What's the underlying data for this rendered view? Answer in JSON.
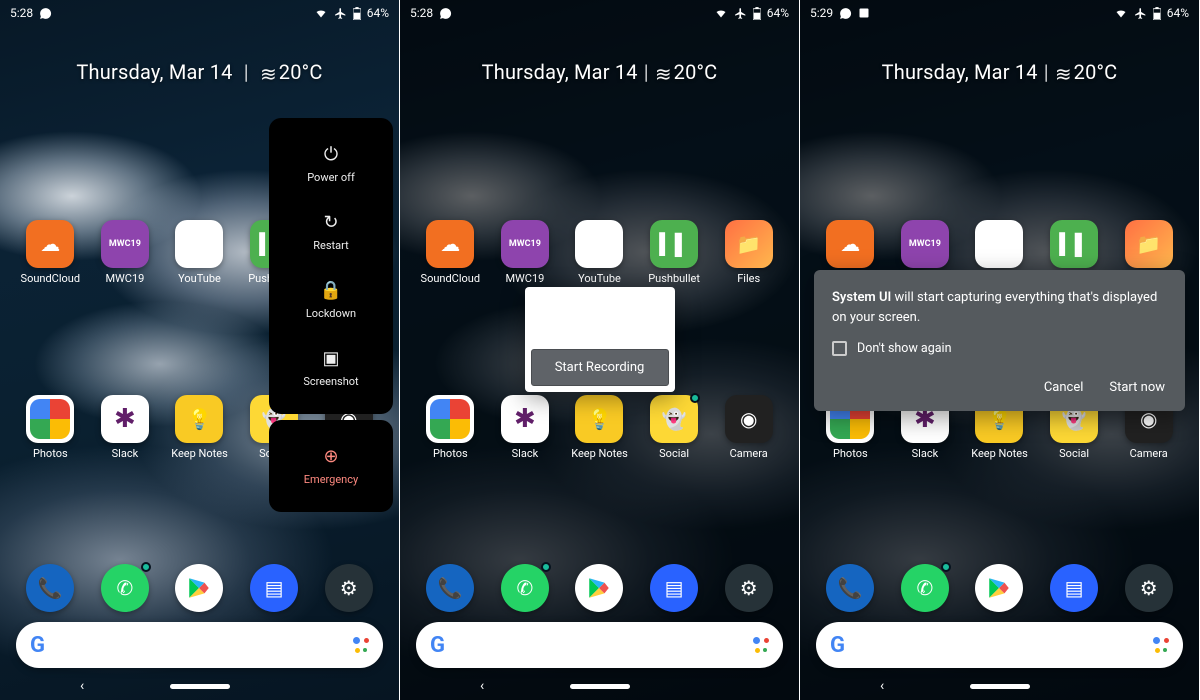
{
  "screens": [
    {
      "time": "5:28",
      "battery": "64%"
    },
    {
      "time": "5:28",
      "battery": "64%"
    },
    {
      "time": "5:29",
      "battery": "64%"
    }
  ],
  "date": "Thursday, Mar 14",
  "temp": "20°C",
  "apps_row1": [
    {
      "name": "SoundCloud",
      "cls": "c-soundcloud",
      "glyph": "☁"
    },
    {
      "name": "MWC19",
      "cls": "c-mwc",
      "glyph": ""
    },
    {
      "name": "YouTube",
      "cls": "c-youtube",
      "glyph": "▶"
    },
    {
      "name": "Pushbullet",
      "cls": "c-pushbullet",
      "glyph": "▍▌"
    },
    {
      "name": "Files",
      "cls": "c-files",
      "glyph": "📁"
    }
  ],
  "apps_row2": [
    {
      "name": "Photos",
      "cls": "c-photos",
      "glyph": ""
    },
    {
      "name": "Slack",
      "cls": "c-slack",
      "glyph": "✱"
    },
    {
      "name": "Keep Notes",
      "cls": "c-keep",
      "glyph": "💡"
    },
    {
      "name": "Social",
      "cls": "c-social",
      "glyph": "👻"
    },
    {
      "name": "Camera",
      "cls": "c-camera",
      "glyph": "◉"
    }
  ],
  "dock": [
    {
      "name": "Phone",
      "cls": "c-phone",
      "glyph": "📞"
    },
    {
      "name": "WhatsApp",
      "cls": "c-whatsapp",
      "glyph": "✆"
    },
    {
      "name": "Play Store",
      "cls": "c-play",
      "glyph": "▶"
    },
    {
      "name": "Messages",
      "cls": "c-messages",
      "glyph": "▤"
    },
    {
      "name": "Settings",
      "cls": "c-settings",
      "glyph": "⚙"
    }
  ],
  "power_menu": [
    {
      "label": "Power off",
      "icon": "⏻"
    },
    {
      "label": "Restart",
      "icon": "↻"
    },
    {
      "label": "Lockdown",
      "icon": "🔒"
    },
    {
      "label": "Screenshot",
      "icon": "▣"
    }
  ],
  "power_emergency": "Emergency",
  "power_emergency_icon": "⊕",
  "record_btn": "Start Recording",
  "capture": {
    "bold": "System UI",
    "rest": " will start capturing everything that's displayed on your screen.",
    "dont_show": "Don't show again",
    "cancel": "Cancel",
    "start": "Start now"
  },
  "mwc_label": "MWC19"
}
